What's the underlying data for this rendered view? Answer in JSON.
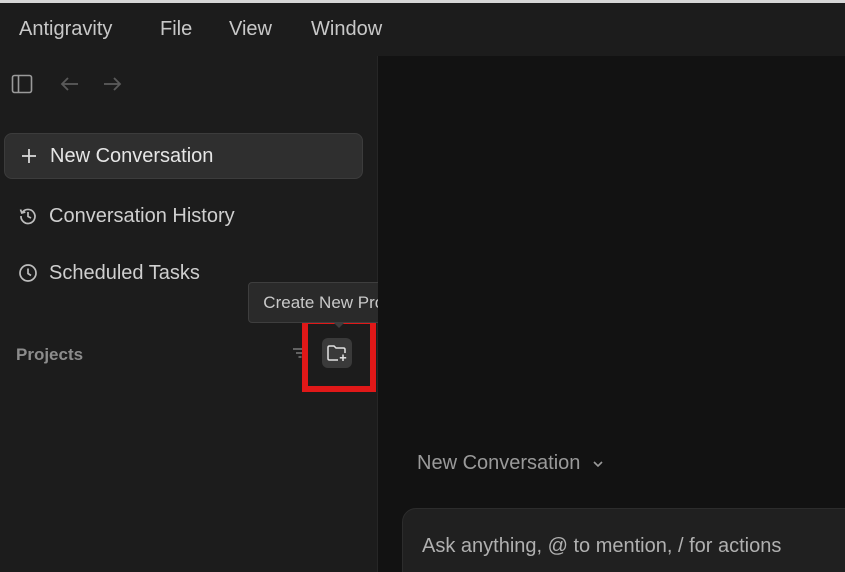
{
  "menubar": {
    "items": [
      "Antigravity",
      "File",
      "View",
      "Window"
    ]
  },
  "sidebar": {
    "toolbar_icons": [
      "sidebar-toggle-icon",
      "arrow-left-icon",
      "arrow-right-icon"
    ],
    "new_conversation": {
      "label": "New Conversation",
      "icon": "plus-icon"
    },
    "items": [
      {
        "label": "Conversation History",
        "icon": "history-icon"
      },
      {
        "label": "Scheduled Tasks",
        "icon": "clock-icon"
      }
    ],
    "projects": {
      "label": "Projects",
      "filter_icon": "filter-icon",
      "new_project_icon": "folder-plus-icon"
    }
  },
  "tooltip": {
    "text": "Create New Project"
  },
  "main": {
    "conversation_title": "New Conversation",
    "chat_input": {
      "placeholder": "Ask anything, @ to mention, / for actions"
    }
  },
  "colors": {
    "highlight": "#e01818",
    "sidebar_bg": "#1c1c1c",
    "main_bg": "#121212"
  }
}
